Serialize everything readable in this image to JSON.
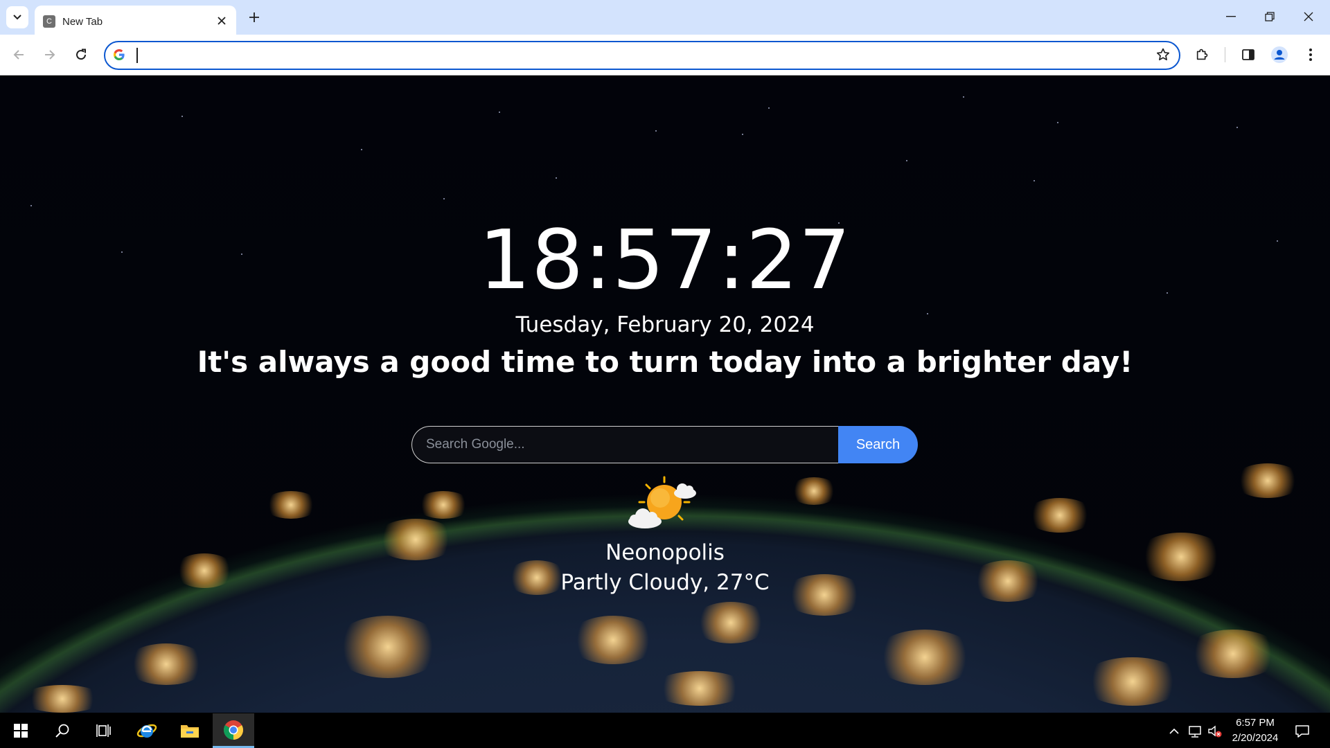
{
  "browser": {
    "tab": {
      "title": "New Tab",
      "favicon_letter": "C"
    },
    "omnibox": {
      "value": "",
      "placeholder": ""
    }
  },
  "page": {
    "clock": "18:57:27",
    "date": "Tuesday, February 20, 2024",
    "quote": "It's always a good time to turn today into a brighter day!",
    "search": {
      "placeholder": "Search Google...",
      "button_label": "Search"
    },
    "weather": {
      "icon": "partly-cloudy-icon",
      "city": "Neonopolis",
      "condition": "Partly Cloudy, 27°C"
    }
  },
  "taskbar": {
    "apps": [
      "windows-start-icon",
      "search-icon",
      "task-view-icon",
      "internet-explorer-icon",
      "file-explorer-icon",
      "chrome-icon"
    ],
    "time": "6:57 PM",
    "date": "2/20/2024"
  },
  "colors": {
    "accent": "#0b57d0",
    "search_button": "#4285f4",
    "tab_strip": "#d3e3fd"
  }
}
